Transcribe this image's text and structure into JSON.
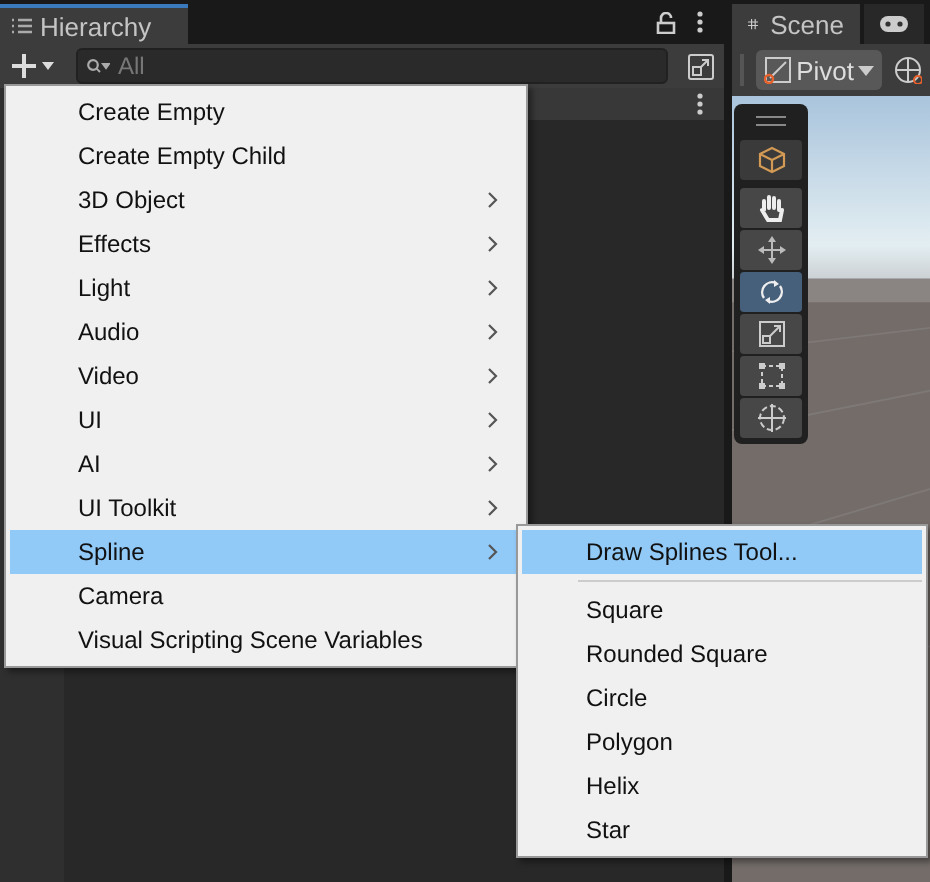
{
  "hierarchy": {
    "title": "Hierarchy",
    "search": {
      "placeholder": "All"
    }
  },
  "scene": {
    "tabs": [
      {
        "kind": "scene",
        "label": "Scene",
        "selected": true
      },
      {
        "kind": "game",
        "selected": false
      }
    ],
    "pivot": "Pivot",
    "tools": [
      {
        "kind": "cube",
        "selected": false
      },
      {
        "kind": "hand",
        "selected": false
      },
      {
        "kind": "move",
        "selected": false
      },
      {
        "kind": "rotate",
        "selected": true
      },
      {
        "kind": "scale",
        "selected": false
      },
      {
        "kind": "rect",
        "selected": false
      },
      {
        "kind": "transform",
        "selected": false
      }
    ]
  },
  "menu": {
    "items": [
      {
        "label": "Create Empty",
        "submenu": false,
        "selected": false
      },
      {
        "label": "Create Empty Child",
        "submenu": false,
        "selected": false
      },
      {
        "label": "3D Object",
        "submenu": true,
        "selected": false
      },
      {
        "label": "Effects",
        "submenu": true,
        "selected": false
      },
      {
        "label": "Light",
        "submenu": true,
        "selected": false
      },
      {
        "label": "Audio",
        "submenu": true,
        "selected": false
      },
      {
        "label": "Video",
        "submenu": true,
        "selected": false
      },
      {
        "label": "UI",
        "submenu": true,
        "selected": false
      },
      {
        "label": "AI",
        "submenu": true,
        "selected": false
      },
      {
        "label": "UI Toolkit",
        "submenu": true,
        "selected": false
      },
      {
        "label": "Spline",
        "submenu": true,
        "selected": true
      },
      {
        "label": "Camera",
        "submenu": false,
        "selected": false
      },
      {
        "label": "Visual Scripting Scene Variables",
        "submenu": false,
        "selected": false
      }
    ]
  },
  "submenu": {
    "items": [
      {
        "kind": "item",
        "label": "Draw Splines Tool...",
        "selected": true
      },
      {
        "kind": "separator"
      },
      {
        "kind": "item",
        "label": "Square",
        "selected": false
      },
      {
        "kind": "item",
        "label": "Rounded Square",
        "selected": false
      },
      {
        "kind": "item",
        "label": "Circle",
        "selected": false
      },
      {
        "kind": "item",
        "label": "Polygon",
        "selected": false
      },
      {
        "kind": "item",
        "label": "Helix",
        "selected": false
      },
      {
        "kind": "item",
        "label": "Star",
        "selected": false
      }
    ]
  }
}
